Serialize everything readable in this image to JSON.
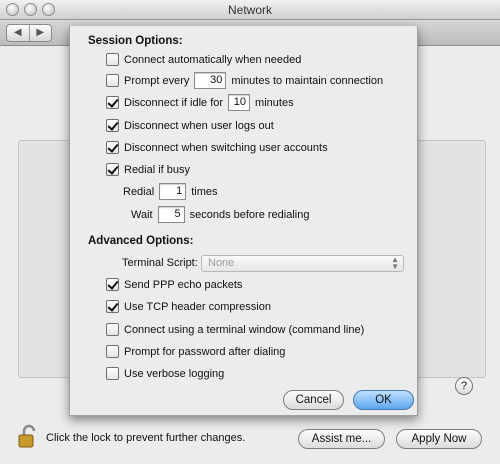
{
  "window": {
    "title": "Network",
    "lock_text": "Click the lock to prevent further changes.",
    "assist_label": "Assist me...",
    "apply_label": "Apply Now",
    "help_label": "?"
  },
  "sheet": {
    "session_title": "Session Options:",
    "session_items": [
      {
        "label": "Connect automatically when needed",
        "checked": false
      },
      {
        "label_before": "Prompt every",
        "value": "30",
        "label_after": "minutes to maintain connection",
        "checked": false
      },
      {
        "label_before": "Disconnect if idle for",
        "value": "10",
        "label_after": "minutes",
        "checked": true
      },
      {
        "label": "Disconnect when user logs out",
        "checked": true
      },
      {
        "label": "Disconnect when switching user accounts",
        "checked": true
      },
      {
        "label": "Redial if busy",
        "checked": true
      }
    ],
    "redial": {
      "label": "Redial",
      "value": "1",
      "suffix": "times"
    },
    "wait": {
      "label": "Wait",
      "value": "5",
      "suffix": "seconds before redialing"
    },
    "advanced_title": "Advanced Options:",
    "terminal_script_label": "Terminal Script:",
    "terminal_script_value": "None",
    "advanced_items": [
      {
        "label": "Send PPP echo packets",
        "checked": true
      },
      {
        "label": "Use TCP header compression",
        "checked": true
      },
      {
        "label": "Connect using a terminal window (command line)",
        "checked": false
      },
      {
        "label": "Prompt for password after dialing",
        "checked": false
      },
      {
        "label": "Use verbose logging",
        "checked": false
      }
    ],
    "cancel_label": "Cancel",
    "ok_label": "OK"
  }
}
